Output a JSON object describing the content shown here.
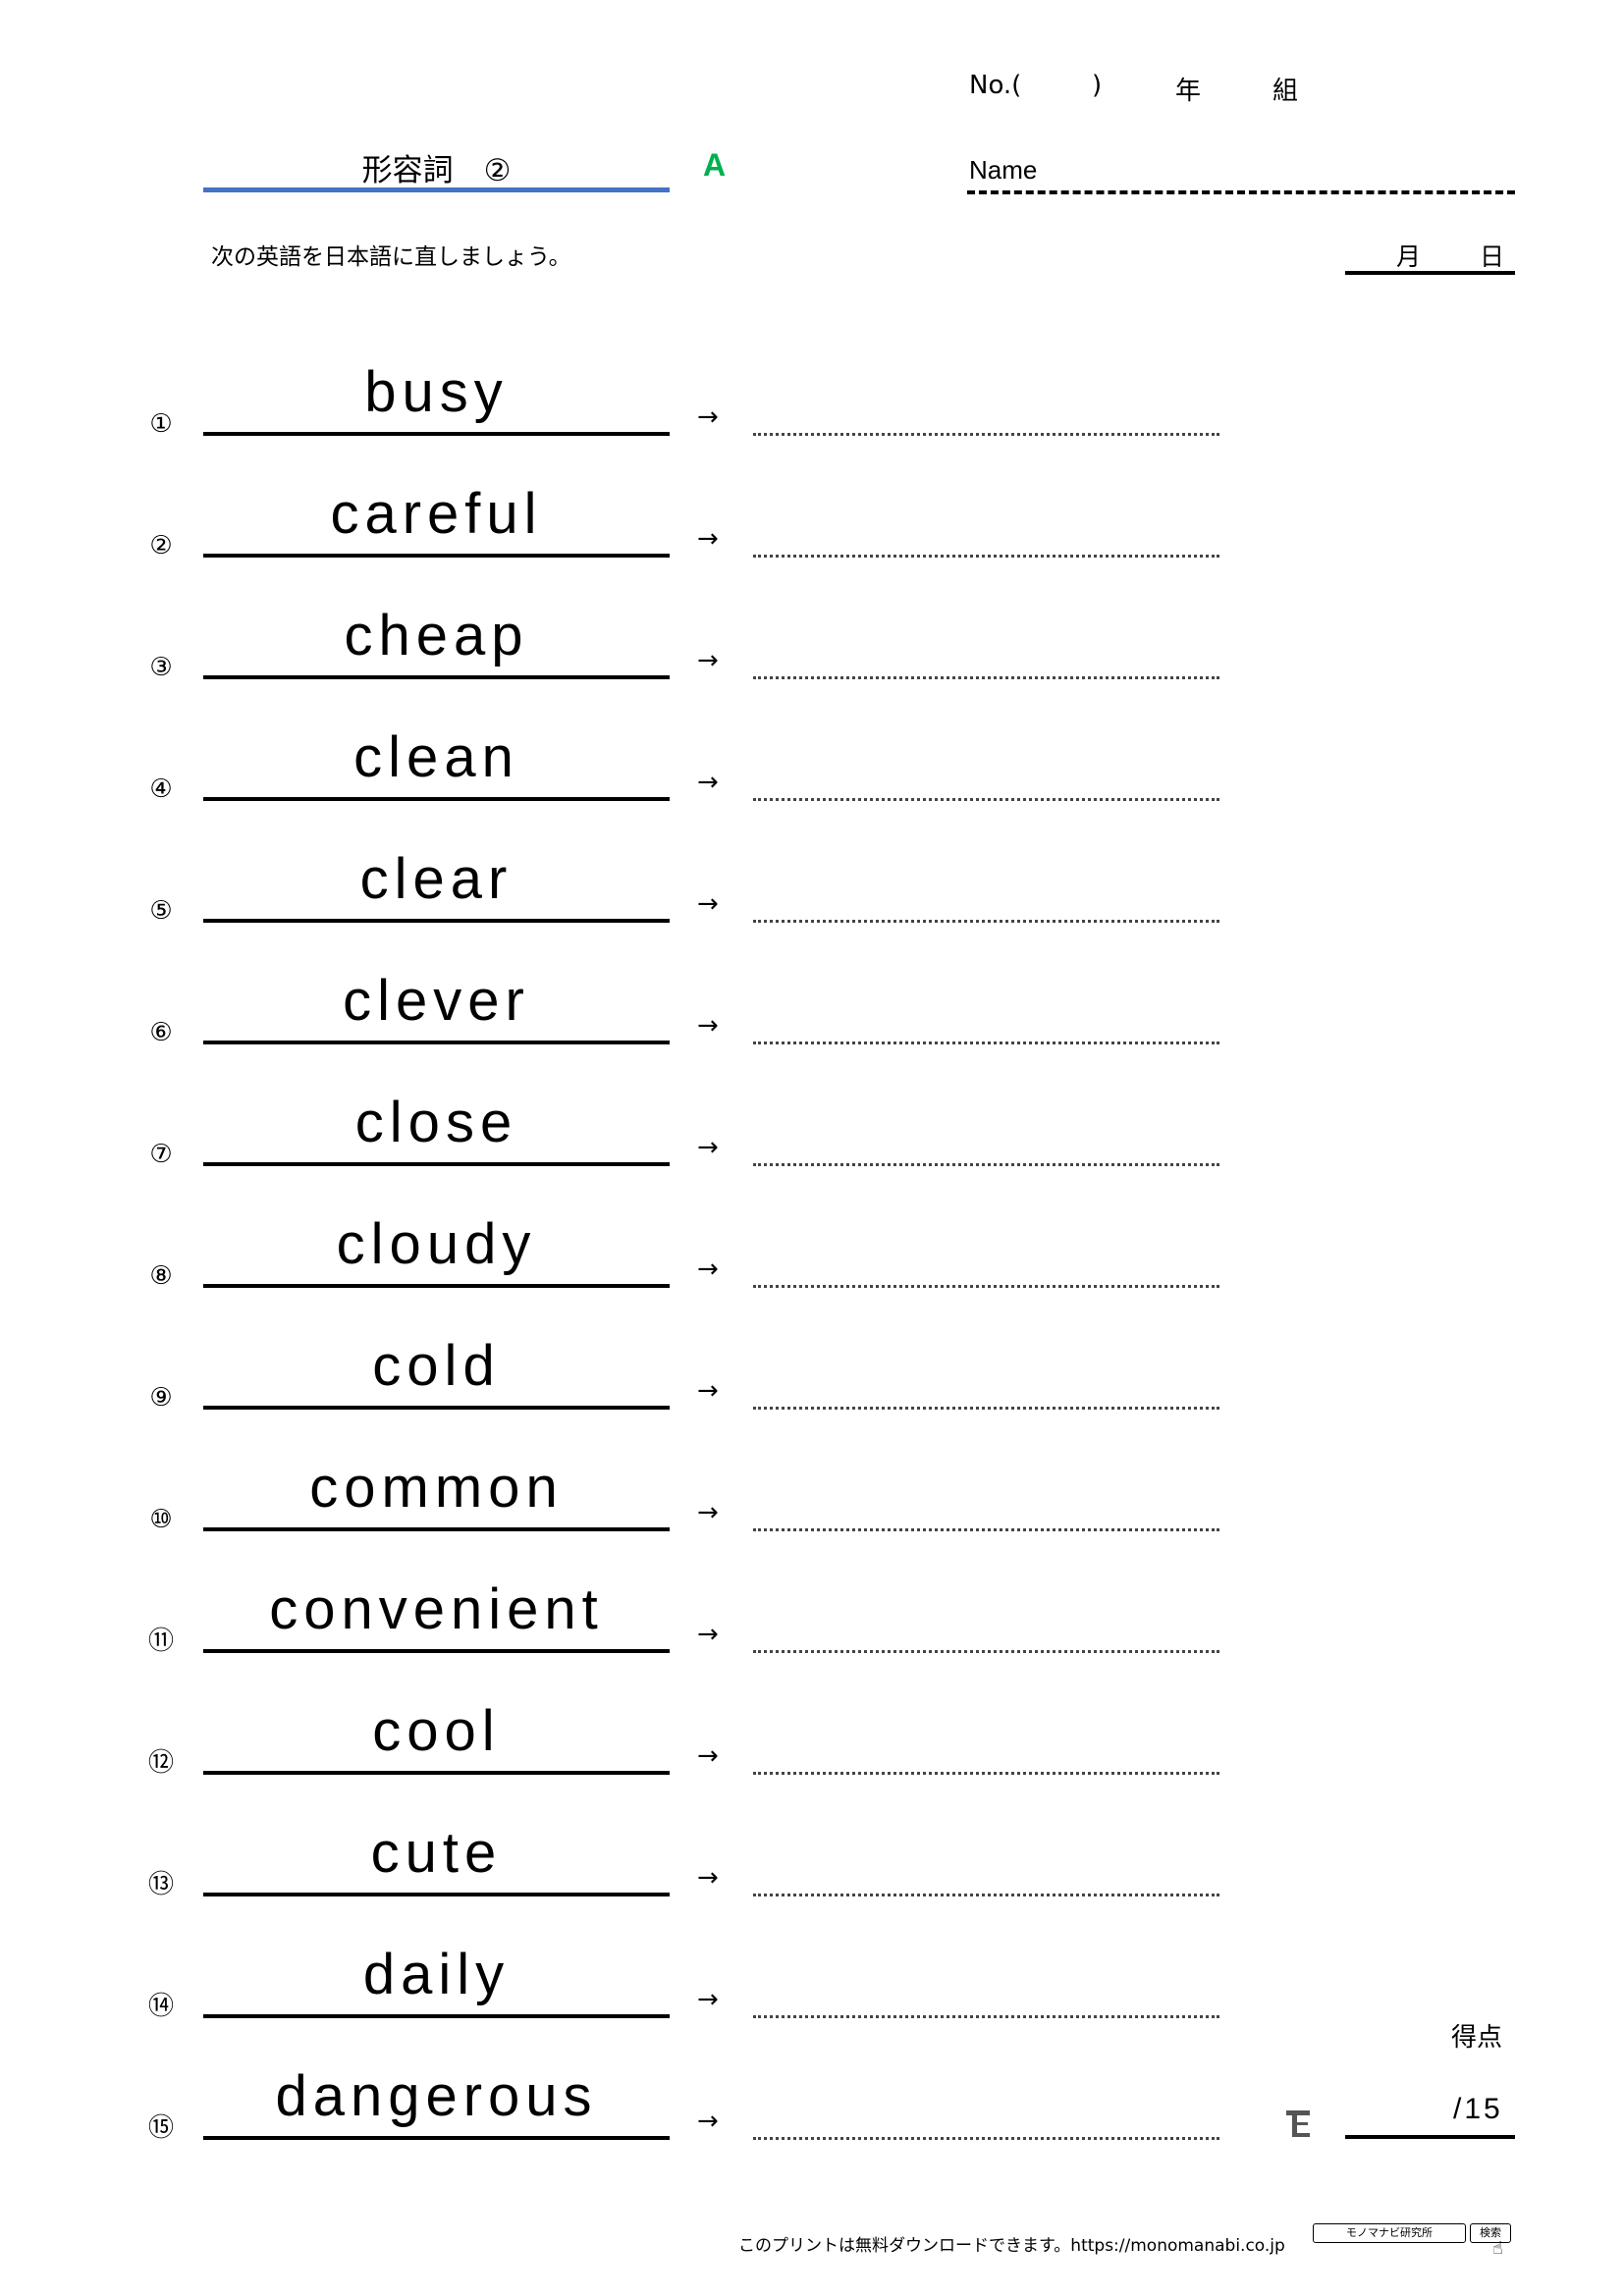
{
  "header": {
    "no_label": "No.(",
    "no_close": ")",
    "year_label": "年",
    "class_label": "組",
    "title": "形容詞　②",
    "variant": "A",
    "name_label": "Name",
    "instruction": "次の英語を日本語に直しましょう。",
    "month_label": "月",
    "day_label": "日",
    "accent_color": "#4472C4",
    "variant_color": "#00B050"
  },
  "items": [
    {
      "num": "①",
      "word": "busy"
    },
    {
      "num": "②",
      "word": "careful"
    },
    {
      "num": "③",
      "word": "cheap"
    },
    {
      "num": "④",
      "word": "clean"
    },
    {
      "num": "⑤",
      "word": "clear"
    },
    {
      "num": "⑥",
      "word": "clever"
    },
    {
      "num": "⑦",
      "word": "close"
    },
    {
      "num": "⑧",
      "word": "cloudy"
    },
    {
      "num": "⑨",
      "word": "cold"
    },
    {
      "num": "⑩",
      "word": "common"
    },
    {
      "num": "⑪",
      "word": "convenient"
    },
    {
      "num": "⑫",
      "word": "cool"
    },
    {
      "num": "⑬",
      "word": "cute"
    },
    {
      "num": "⑭",
      "word": "daily"
    },
    {
      "num": "⑮",
      "word": "dangerous"
    }
  ],
  "arrow": "→",
  "score": {
    "label": "得点",
    "total": "/15"
  },
  "footer": {
    "text": "このプリントは無料ダウンロードできます。https://monomanabi.co.jp",
    "search_box": "モノマナビ研究所",
    "search_button": "検索"
  }
}
